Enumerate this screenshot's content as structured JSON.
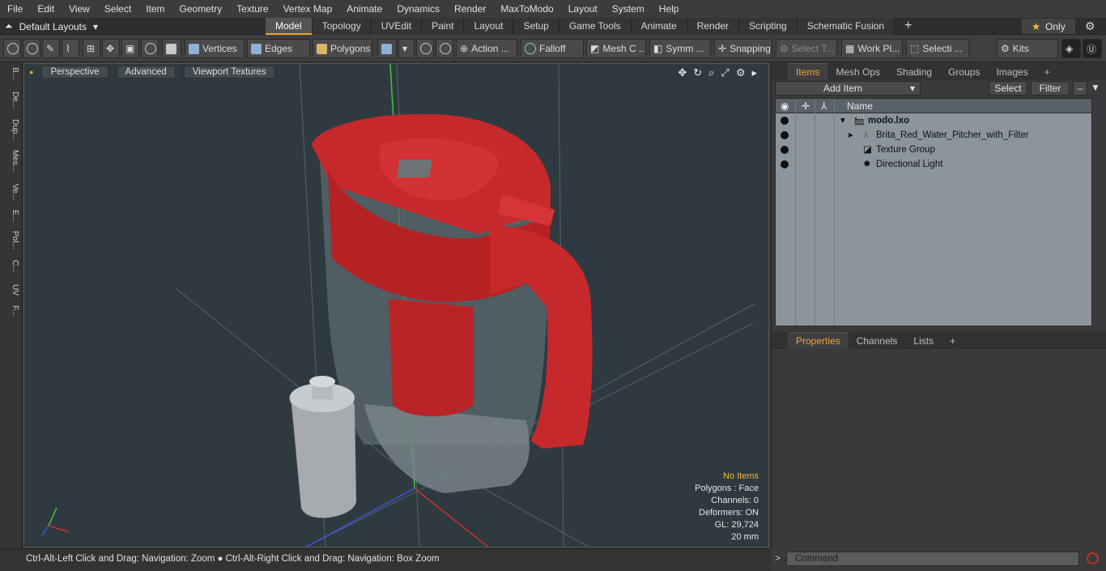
{
  "menu": [
    "File",
    "Edit",
    "View",
    "Select",
    "Item",
    "Geometry",
    "Texture",
    "Vertex Map",
    "Animate",
    "Dynamics",
    "Render",
    "MaxToModo",
    "Layout",
    "System",
    "Help"
  ],
  "layout_selector": "Default Layouts",
  "tabs": [
    "Model",
    "Topology",
    "UVEdit",
    "Paint",
    "Layout",
    "Setup",
    "Game Tools",
    "Animate",
    "Render",
    "Scripting",
    "Schematic Fusion"
  ],
  "active_tab": "Model",
  "only_label": "Only",
  "toolbar": {
    "vertices": "Vertices",
    "edges": "Edges",
    "polygons": "Polygons",
    "action": "Action ...",
    "falloff": "Falloff",
    "mesh": "Mesh C ...",
    "symm": "Symm ...",
    "snapping": "Snapping",
    "select_t": "Select T...",
    "work_pl": "Work Pl...",
    "selecti": "Selecti ...",
    "kits": "Kits"
  },
  "left_tabs": [
    "B...",
    "De...",
    "Dup...",
    "Mes...",
    "Ve...",
    "E...",
    "Pol...",
    "C...",
    "UV",
    "F..."
  ],
  "viewport": {
    "perspective": "Perspective",
    "advanced": "Advanced",
    "textures": "Viewport Textures",
    "stats": {
      "no_items": "No Items",
      "polygons": "Polygons : Face",
      "channels": "Channels: 0",
      "deformers": "Deformers: ON",
      "gl": "GL: 29,724",
      "scale": "20 mm"
    }
  },
  "status": "Ctrl-Alt-Left Click and Drag: Navigation: Zoom ● Ctrl-Alt-Right Click and Drag: Navigation: Box Zoom",
  "panel": {
    "tabs": [
      "Items",
      "Mesh Ops",
      "Shading",
      "Groups",
      "Images"
    ],
    "add_item": "Add Item",
    "select": "Select",
    "filter": "Filter",
    "name_header": "Name",
    "items": [
      "modo.lxo",
      "Brita_Red_Water_Pitcher_with_Filter",
      "Texture Group",
      "Directional Light"
    ],
    "props_tabs": [
      "Properties",
      "Channels",
      "Lists"
    ],
    "command_placeholder": "Command"
  },
  "colors": {
    "accent": "#e8a33b",
    "pitcher": "#c8262a",
    "viewport_bg": "#2f3a40"
  }
}
